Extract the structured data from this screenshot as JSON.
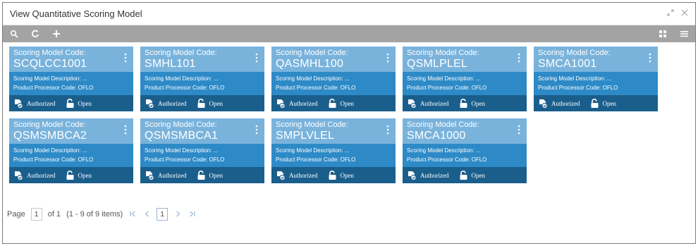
{
  "window": {
    "title": "View Quantitative Scoring Model"
  },
  "toolbar": {
    "search_icon": "search-icon",
    "refresh_icon": "refresh-icon",
    "add_icon": "add-icon",
    "grid_icon": "grid-view-icon",
    "list_icon": "list-view-icon"
  },
  "tiles": [
    {
      "code_label": "Scoring Model Code:",
      "code": "SCQLCC1001",
      "description": "Scoring Model Description: ...",
      "processor": "Product Processor Code: OFLO",
      "auth_status": "Authorized",
      "record_status": "Open"
    },
    {
      "code_label": "Scoring Model Code:",
      "code": "SMHL101",
      "description": "Scoring Model Description: ...",
      "processor": "Product Processor Code: OFLO",
      "auth_status": "Authorized",
      "record_status": "Open"
    },
    {
      "code_label": "Scoring Model Code:",
      "code": "QASMHL100",
      "description": "Scoring Model Description: ...",
      "processor": "Product Processor Code: OFLO",
      "auth_status": "Authorized",
      "record_status": "Open"
    },
    {
      "code_label": "Scoring Model Code:",
      "code": "QSMLPLEL",
      "description": "Scoring Model Description: ...",
      "processor": "Product Processor Code: OFLO",
      "auth_status": "Authorized",
      "record_status": "Open"
    },
    {
      "code_label": "Scoring Model Code:",
      "code": "SMCA1001",
      "description": "Scoring Model Description: ...",
      "processor": "Product Processor Code: OFLO",
      "auth_status": "Authorized",
      "record_status": "Open"
    },
    {
      "code_label": "Scoring Model Code:",
      "code": "QSMSMBCA2",
      "description": "Scoring Model Description: ...",
      "processor": "Product Processor Code: OFLO",
      "auth_status": "Authorized",
      "record_status": "Open"
    },
    {
      "code_label": "Scoring Model Code:",
      "code": "QSMSMBCA1",
      "description": "Scoring Model Description: ...",
      "processor": "Product Processor Code: OFLO",
      "auth_status": "Authorized",
      "record_status": "Open"
    },
    {
      "code_label": "Scoring Model Code:",
      "code": "SMPLVLEL",
      "description": "Scoring Model Description: ...",
      "processor": "Product Processor Code: OFLO",
      "auth_status": "Authorized",
      "record_status": "Open"
    },
    {
      "code_label": "Scoring Model Code:",
      "code": "SMCA1000",
      "description": "Scoring Model Description: ...",
      "processor": "Product Processor Code: OFLO",
      "auth_status": "Authorized",
      "record_status": "Open"
    }
  ],
  "pager": {
    "page_label": "Page",
    "page_input": "1",
    "of_text": "of 1",
    "range_text": "(1 - 9 of 9 items)",
    "current_page": "1"
  },
  "colors": {
    "tile_head": "#79b3dc",
    "tile_body": "#2d8ac7",
    "tile_foot": "#1a5e8c",
    "toolbar": "#a3a3a3"
  }
}
